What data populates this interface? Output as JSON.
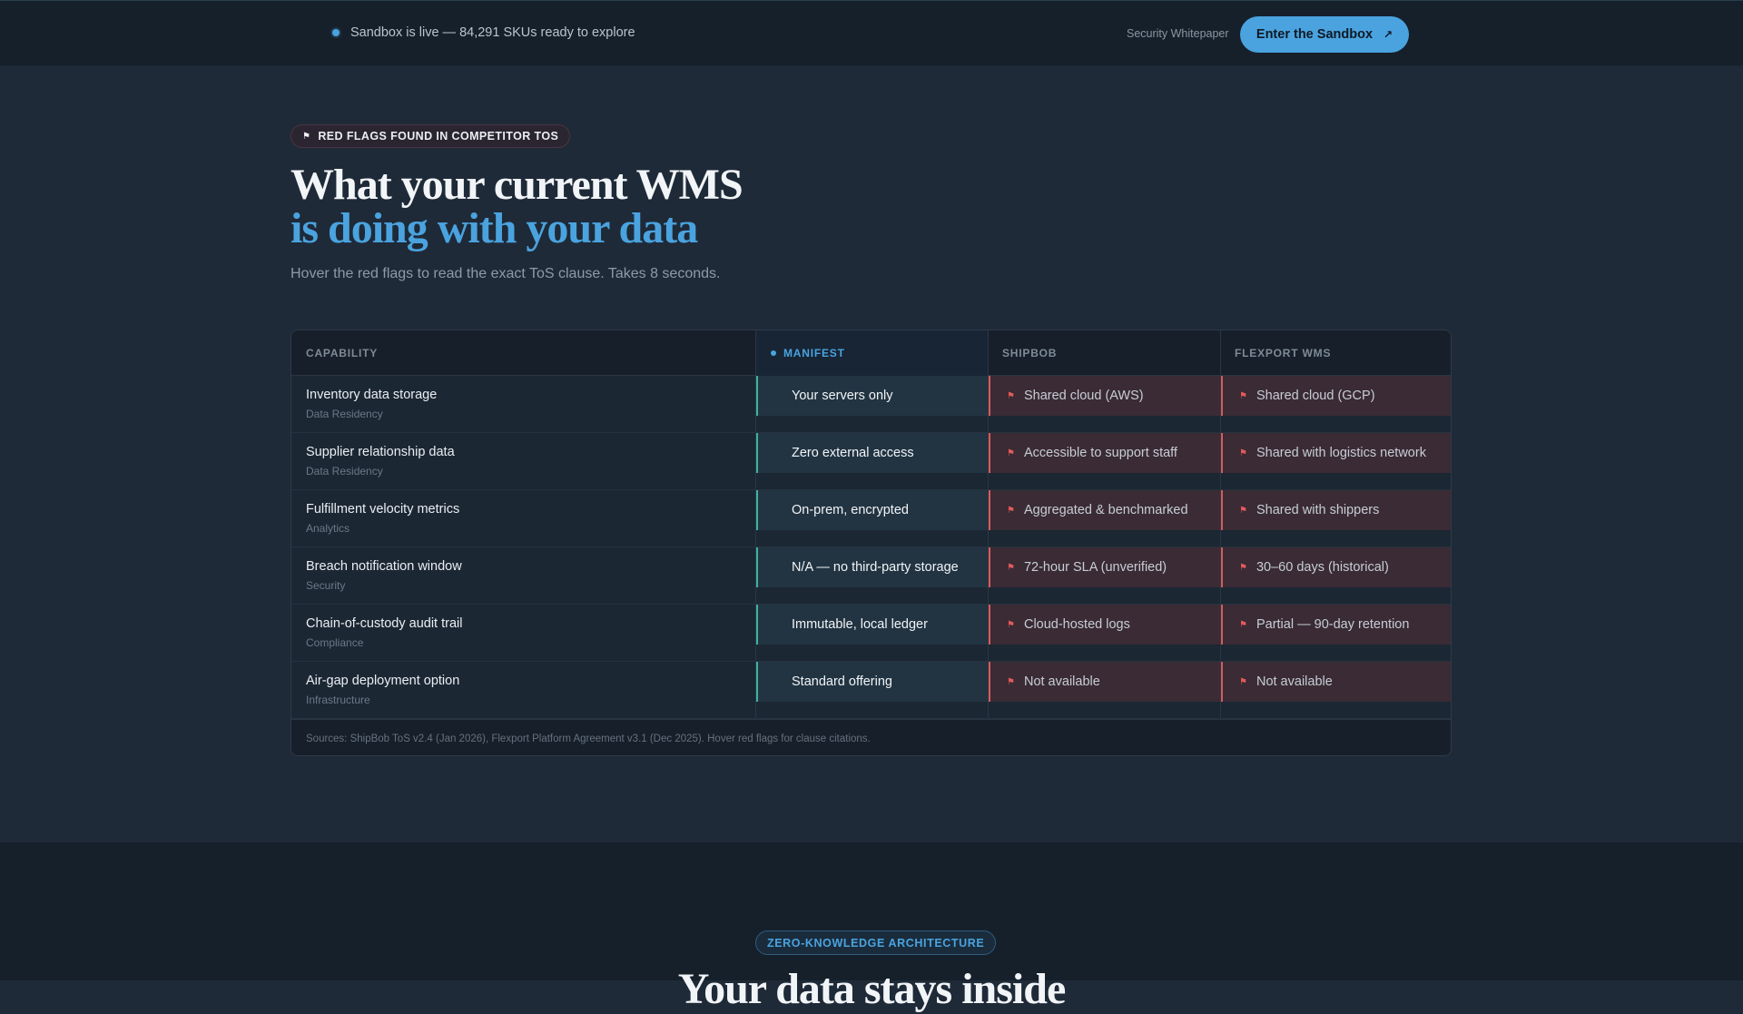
{
  "topbar": {
    "live_text": "Sandbox is live — 84,291 SKUs ready to explore",
    "whitepaper_link": "Security Whitepaper",
    "cta_label": "Enter the Sandbox",
    "cta_icon": "arrow-up-right-icon"
  },
  "hero": {
    "badge": "RED FLAGS FOUND IN COMPETITOR TOS",
    "title_line1": "What your current WMS",
    "title_line2": "is doing with your data",
    "subtitle": "Hover the red flags to read the exact ToS clause. Takes 8 seconds."
  },
  "table": {
    "headers": [
      "CAPABILITY",
      "MANIFEST",
      "SHIPBOB",
      "FLEXPORT WMS"
    ],
    "rows": [
      {
        "name": "Inventory data storage",
        "category": "Data Residency",
        "manifest": "Your servers only",
        "shipbob": "Shared cloud (AWS)",
        "flexport": "Shared cloud (GCP)"
      },
      {
        "name": "Supplier relationship data",
        "category": "Data Residency",
        "manifest": "Zero external access",
        "shipbob": "Accessible to support staff",
        "flexport": "Shared with logistics network"
      },
      {
        "name": "Fulfillment velocity metrics",
        "category": "Analytics",
        "manifest": "On-prem, encrypted",
        "shipbob": "Aggregated & benchmarked",
        "flexport": "Shared with shippers"
      },
      {
        "name": "Breach notification window",
        "category": "Security",
        "manifest": "N/A — no third-party storage",
        "shipbob": "72-hour SLA (unverified)",
        "flexport": "30–60 days (historical)"
      },
      {
        "name": "Chain-of-custody audit trail",
        "category": "Compliance",
        "manifest": "Immutable, local ledger",
        "shipbob": "Cloud-hosted logs",
        "flexport": "Partial — 90-day retention"
      },
      {
        "name": "Air-gap deployment option",
        "category": "Infrastructure",
        "manifest": "Standard offering",
        "shipbob": "Not available",
        "flexport": "Not available"
      }
    ],
    "footnote": "Sources: ShipBob ToS v2.4 (Jan 2026), Flexport Platform Agreement v3.1 (Dec 2025). Hover red flags for clause citations."
  },
  "bottom": {
    "badge": "ZERO-KNOWLEDGE ARCHITECTURE",
    "heading": "Your data stays inside"
  },
  "colors": {
    "accent": "#4aa3df",
    "success": "#3fb3a0",
    "danger": "#d85a5a"
  }
}
